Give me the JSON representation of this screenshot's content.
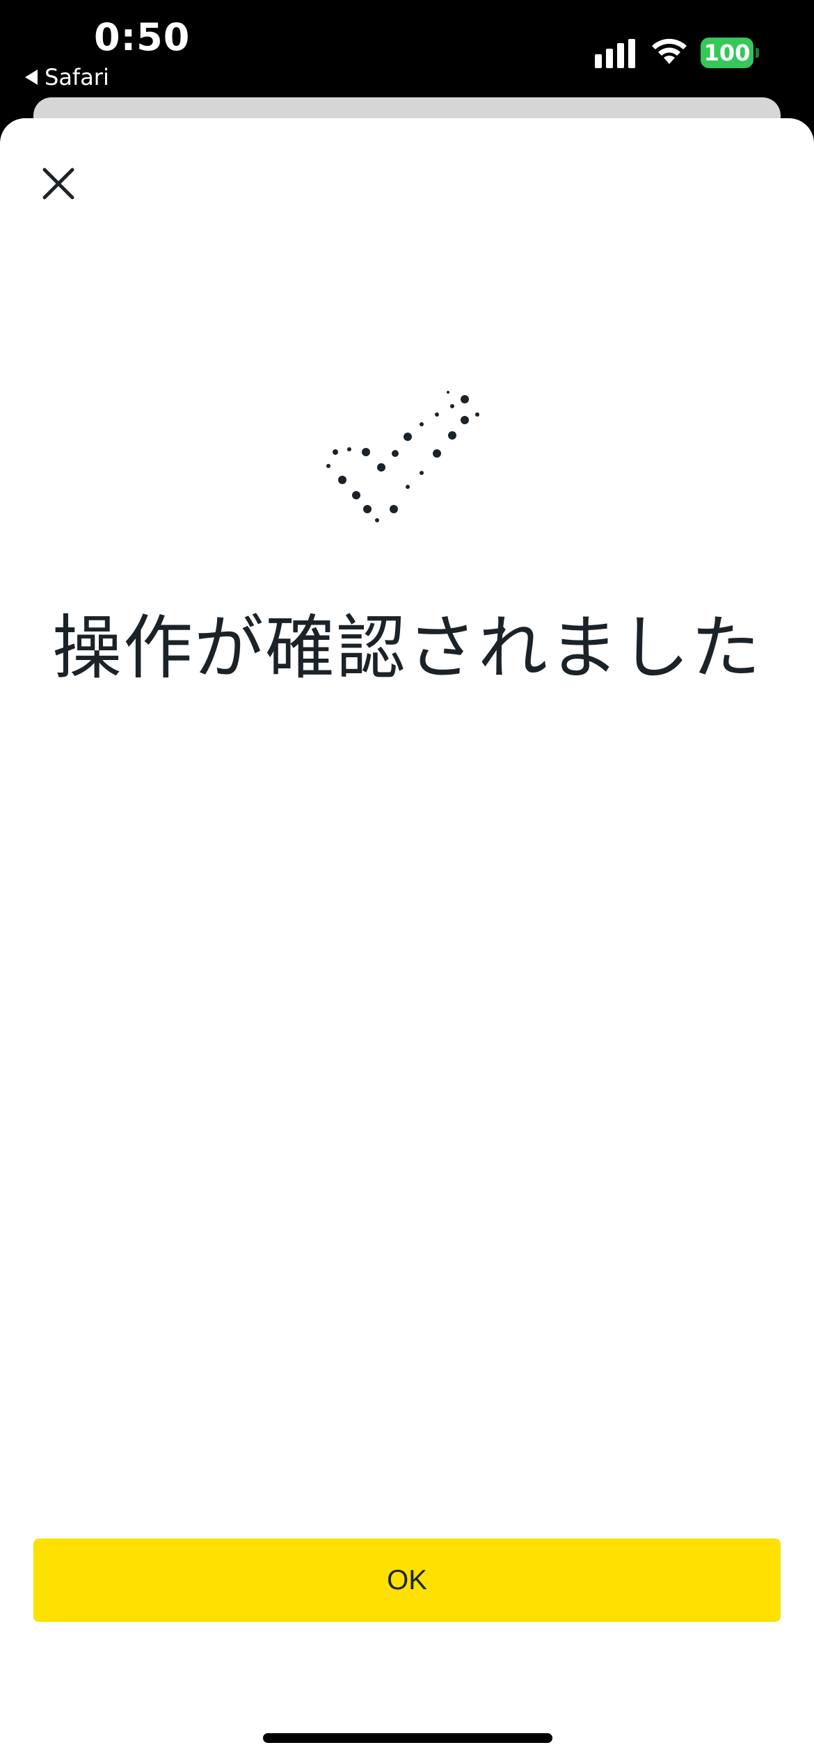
{
  "status_bar": {
    "time": "0:50",
    "back_app_label": "Safari",
    "battery_level": "100",
    "signal_icon": "cellular-signal-icon",
    "wifi_icon": "wifi-icon"
  },
  "modal": {
    "close_icon": "close-icon",
    "graphic_icon": "dotted-checkmark-icon",
    "message": "操作が確認されました",
    "ok_label": "OK"
  },
  "colors": {
    "accent_button": "#ffe000",
    "text_primary": "#1b2329",
    "battery_green": "#34c759"
  }
}
